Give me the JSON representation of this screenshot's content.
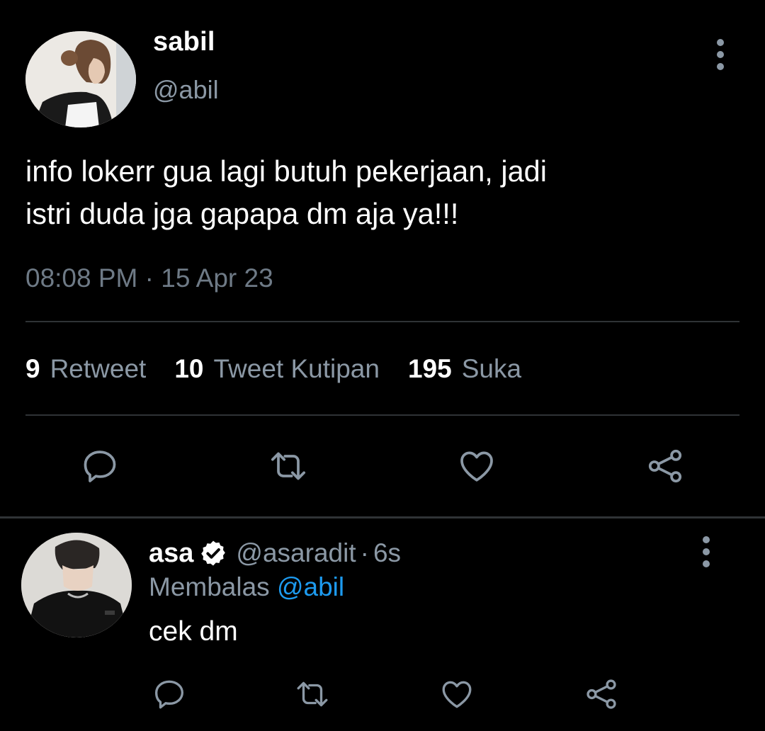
{
  "tweet": {
    "author_name": "sabil",
    "author_handle": "@abil",
    "text": "info lokerr gua lagi butuh pekerjaan, jadi\nistri duda jga gapapa dm aja ya!!!",
    "timestamp": "08:08 PM · 15 Apr 23",
    "stats": {
      "retweets_count": "9",
      "retweets_label": "Retweet",
      "quotes_count": "10",
      "quotes_label": "Tweet Kutipan",
      "likes_count": "195",
      "likes_label": "Suka"
    },
    "actions": [
      "reply-icon",
      "retweet-icon",
      "like-icon",
      "share-icon"
    ]
  },
  "reply": {
    "author_name": "asa",
    "verified": true,
    "author_handle": "@asaradit",
    "separator": "·",
    "time_ago": "6s",
    "replying_prefix": "Membalas",
    "replying_to": "@abil",
    "text": "cek dm",
    "actions": [
      "reply-icon",
      "retweet-icon",
      "like-icon",
      "share-icon"
    ]
  },
  "colors": {
    "background": "#000000",
    "text_primary": "#ffffff",
    "text_secondary": "#8b98a5",
    "accent": "#1d9bf0",
    "divider": "#2f3336"
  }
}
